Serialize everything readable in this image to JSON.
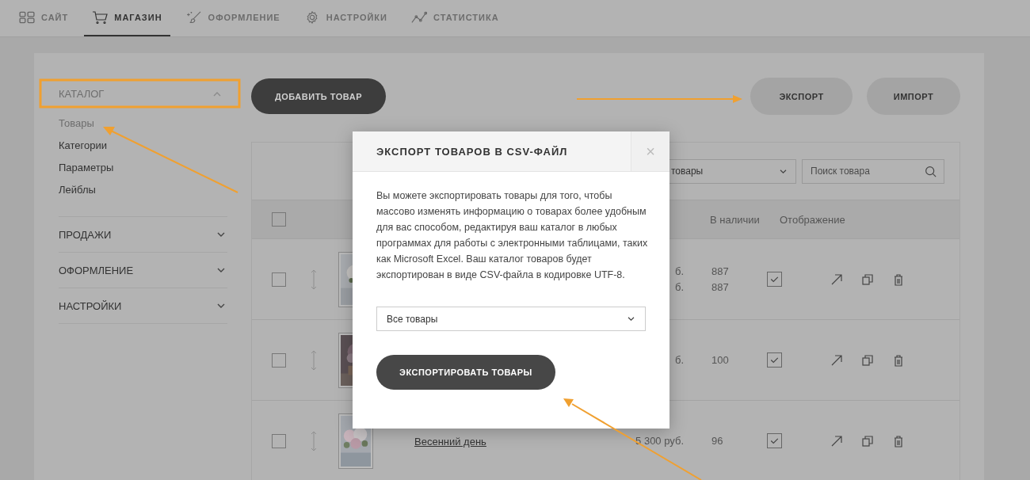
{
  "nav": {
    "tabs": [
      {
        "kind": "site",
        "label": "САЙТ",
        "selected": false
      },
      {
        "kind": "shop",
        "label": "МАГАЗИН",
        "selected": true
      },
      {
        "kind": "design",
        "label": "ОФОРМЛЕНИЕ",
        "selected": false
      },
      {
        "kind": "settings",
        "label": "НАСТРОЙКИ",
        "selected": false
      },
      {
        "kind": "stats",
        "label": "СТАТИСТИКА",
        "selected": false
      }
    ]
  },
  "sidebar": {
    "catalog": {
      "label": "КАТАЛОГ",
      "expanded": true,
      "items": [
        {
          "label": "Товары",
          "selected": true
        },
        {
          "label": "Категории",
          "selected": false
        },
        {
          "label": "Параметры",
          "selected": false
        },
        {
          "label": "Лейблы",
          "selected": false
        }
      ]
    },
    "sections": [
      {
        "label": "ПРОДАЖИ",
        "expanded": false
      },
      {
        "label": "ОФОРМЛЕНИЕ",
        "expanded": false
      },
      {
        "label": "НАСТРОЙКИ",
        "expanded": false
      }
    ]
  },
  "toolbar": {
    "add_button": "ДОБАВИТЬ ТОВАР",
    "export_button": "ЭКСПОРТ",
    "import_button": "ИМПОРТ"
  },
  "filter": {
    "value": "товары"
  },
  "search": {
    "placeholder": "Поиск товара"
  },
  "table": {
    "select_all": {
      "checked": false
    },
    "columns": [
      "В наличии",
      "Отображение"
    ],
    "rows": [
      {
        "checked": false,
        "price": [
          "б.",
          "б."
        ],
        "stock": [
          "887",
          "887"
        ],
        "visible": true
      },
      {
        "checked": false,
        "price": [
          "б."
        ],
        "stock": [
          "100"
        ],
        "visible": true
      },
      {
        "checked": false,
        "name": "Весенний день",
        "price": [
          "5 300 руб."
        ],
        "stock": [
          "96"
        ],
        "visible": true
      }
    ]
  },
  "modal": {
    "title": "ЭКСПОРТ ТОВАРОВ В CSV-ФАЙЛ",
    "close": "×",
    "text": "Вы можете экспортировать товары для того, чтобы массово изменять информацию о товарах более удобным для вас способом, редактируя ваш каталог в любых программах для работы с электронными таблицами, таких как Microsoft Excel. Ваш каталог товаров будет экспортирован в виде CSV-файла в кодировке UTF-8.",
    "select": {
      "value": "Все товары"
    },
    "button": "ЭКСПОРТИРОВАТЬ ТОВАРЫ"
  }
}
